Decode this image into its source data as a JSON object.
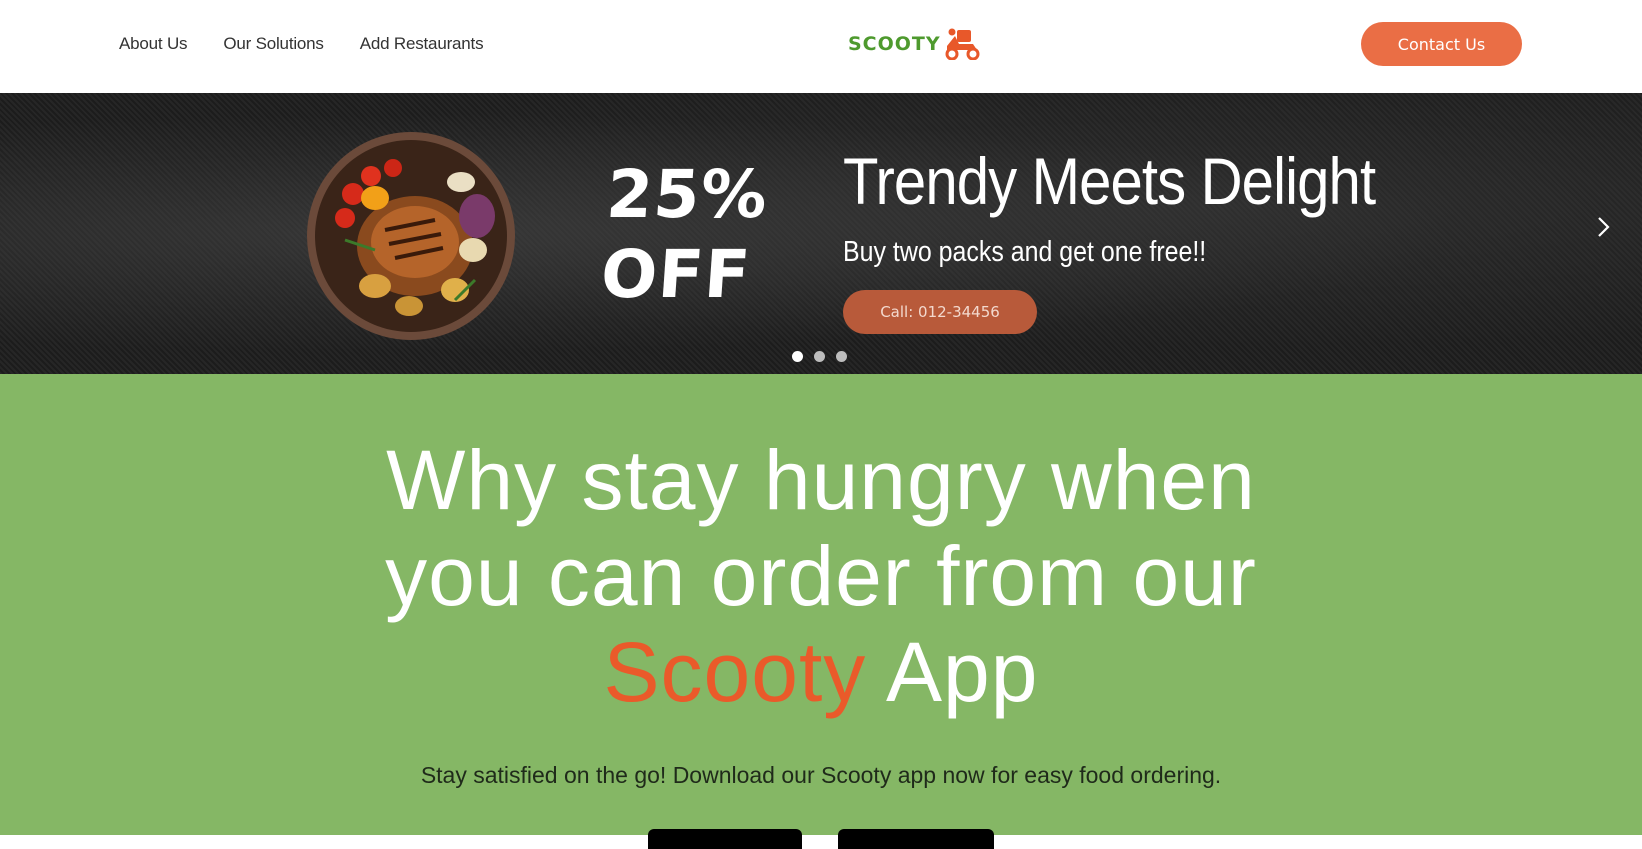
{
  "header": {
    "nav": [
      {
        "label": "About Us"
      },
      {
        "label": "Our Solutions"
      },
      {
        "label": "Add Restaurants"
      }
    ],
    "logo_text": "SCOOTY",
    "contact_label": "Contact Us"
  },
  "banner": {
    "discount_line1": "25%",
    "discount_line2": "OFF",
    "title": "Trendy Meets Delight",
    "subtitle": "Buy two packs and get one free!!",
    "call_label": "Call: 012-34456",
    "slides": 3,
    "active_slide": 1
  },
  "hero": {
    "line1": "Why stay hungry when",
    "line2": "you can order from our",
    "accent_word": "Scooty",
    "line3_rest": " App",
    "tagline": "Stay satisfied on the go! Download our Scooty app now for easy food ordering."
  },
  "colors": {
    "accent": "#ea6e45",
    "hero_accent": "#ea5a2a",
    "green_bg": "#85b765",
    "logo_green": "#4e9a2e"
  },
  "icons": {
    "logo": "scooter-icon",
    "next": "chevron-right-icon"
  }
}
